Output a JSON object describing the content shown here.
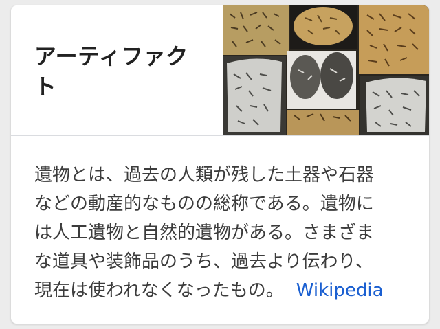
{
  "entity": {
    "title_line1": "アーティファク",
    "title_line2": "ト"
  },
  "description": {
    "lines": [
      "遺物とは、過去の人類が残した土器や石器",
      "などの動産的なものの総称である。遺物に",
      "は人工遺物と自然的遺物がある。さまざま",
      "な道具や装飾品のうち、過去より伝わり、",
      "現在は使われなくなったもの。"
    ],
    "source_label": "Wikipedia"
  },
  "colors": {
    "link": "#1a5fd1",
    "title": "#222222",
    "body_text": "#3c3c3c",
    "card_background": "#ffffff",
    "page_background": "#ececec"
  },
  "images": {
    "collage": "artifact-tablet-thumbnails"
  }
}
